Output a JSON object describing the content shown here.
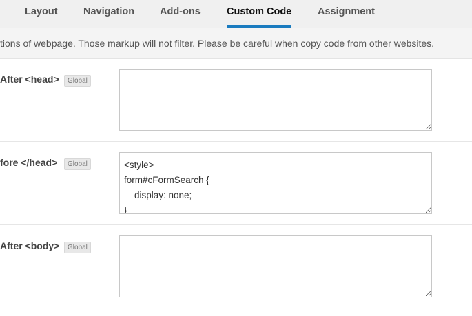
{
  "tabs": [
    {
      "label": "Layout",
      "active": false
    },
    {
      "label": "Navigation",
      "active": false
    },
    {
      "label": "Add-ons",
      "active": false
    },
    {
      "label": "Custom Code",
      "active": true
    },
    {
      "label": "Assignment",
      "active": false
    }
  ],
  "notice": "tions of webpage. Those markup will not filter. Please be careful when copy code from other websites.",
  "rows": [
    {
      "label": "After <head>",
      "badge": "Global",
      "code": ""
    },
    {
      "label": "fore </head>",
      "badge": "Global",
      "code": "<style>\nform#cFormSearch {\n    display: none;\n}"
    },
    {
      "label": "After <body>",
      "badge": "Global",
      "code": ""
    }
  ],
  "colors": {
    "accent": "#1a7bbf"
  }
}
